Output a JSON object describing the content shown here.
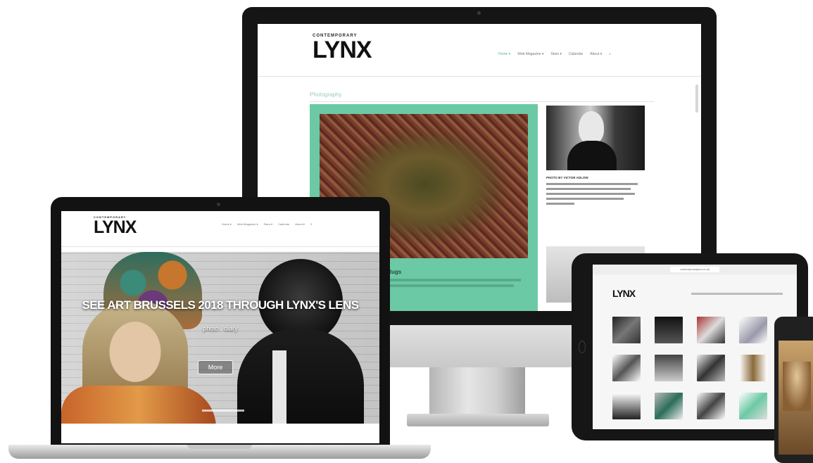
{
  "desktop": {
    "logo_small": "CONTEMPORARY",
    "logo": "LYNX",
    "nav": [
      {
        "label": "Home ▾",
        "active": true
      },
      {
        "label": "Web Magazine ▾",
        "active": false
      },
      {
        "label": "Stars ▾",
        "active": false
      },
      {
        "label": "Calendar",
        "active": false
      },
      {
        "label": "About ▾",
        "active": false
      }
    ],
    "section_title": "Photography",
    "featured_caption": "… Rugs",
    "featured_excerpt": "… … …",
    "side_caption": "PHOTO BY VICTOR ADLOW",
    "side_text": "… … …",
    "accent_color": "#6cc9a5"
  },
  "laptop": {
    "logo_small": "CONTEMPORARY",
    "logo": "LYNX",
    "nav": [
      "Home ▾",
      "Web Magazine ▾",
      "Stars ▾",
      "Calendar",
      "About ▾"
    ],
    "hero_title": "SEE ART BRUSSELS 2018 THROUGH LYNX'S LENS",
    "hero_subtitle": "photo . diary",
    "hero_button": "More"
  },
  "tablet": {
    "url": "contemporarylynx.co.uk",
    "logo": "LYNX"
  },
  "colors": {
    "accent": "#6cc9a5",
    "device_black": "#151515"
  }
}
